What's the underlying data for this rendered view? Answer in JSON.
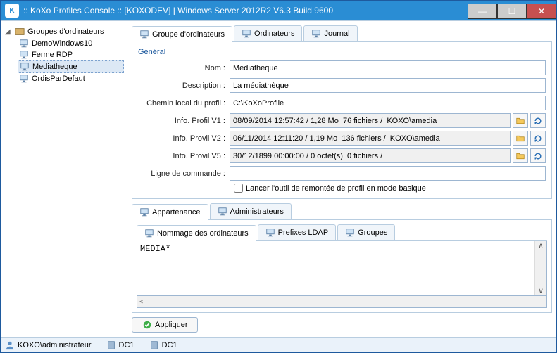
{
  "window": {
    "title": ":: KoXo Profiles Console :: [KOXODEV]  | Windows Server 2012R2 V6.3 Build 9600"
  },
  "tree": {
    "root": "Groupes d'ordinateurs",
    "items": [
      {
        "label": "DemoWindows10",
        "selected": false
      },
      {
        "label": "Ferme RDP",
        "selected": false
      },
      {
        "label": "Mediatheque",
        "selected": true
      },
      {
        "label": "OrdisParDefaut",
        "selected": false
      }
    ]
  },
  "mainTabs": [
    {
      "label": "Groupe d'ordinateurs",
      "active": true
    },
    {
      "label": "Ordinateurs",
      "active": false
    },
    {
      "label": "Journal",
      "active": false
    }
  ],
  "general": {
    "title": "Général",
    "labels": {
      "nom": "Nom :",
      "desc": "Description :",
      "chemin": "Chemin local du profil :",
      "v1": "Info. Profil V1 :",
      "v2": "Info. Provil V2 :",
      "v5": "Info. Provil V5 :",
      "cmd": "Ligne de commande :"
    },
    "nom": "Mediatheque",
    "desc": "La médiathèque",
    "chemin": "C:\\KoXoProfile",
    "v1": "08/09/2014 12:57:42 / 1,28 Mo  76 fichiers /  KOXO\\amedia",
    "v2": "06/11/2014 12:11:20 / 1,19 Mo  136 fichiers /  KOXO\\amedia",
    "v5": "30/12/1899 00:00:00 / 0 octet(s)  0 fichiers /",
    "cmd": "",
    "checkbox": "Lancer l'outil de remontée de profil en mode basique"
  },
  "subTabs1": [
    {
      "label": "Appartenance",
      "active": true
    },
    {
      "label": "Administrateurs",
      "active": false
    }
  ],
  "subTabs2": [
    {
      "label": "Nommage des ordinateurs",
      "active": true
    },
    {
      "label": "Prefixes LDAP",
      "active": false
    },
    {
      "label": "Groupes",
      "active": false
    }
  ],
  "naming": "MEDIA*",
  "apply": "Appliquer",
  "status": {
    "user": "KOXO\\administrateur",
    "dc1": "DC1",
    "dc2": "DC1"
  }
}
